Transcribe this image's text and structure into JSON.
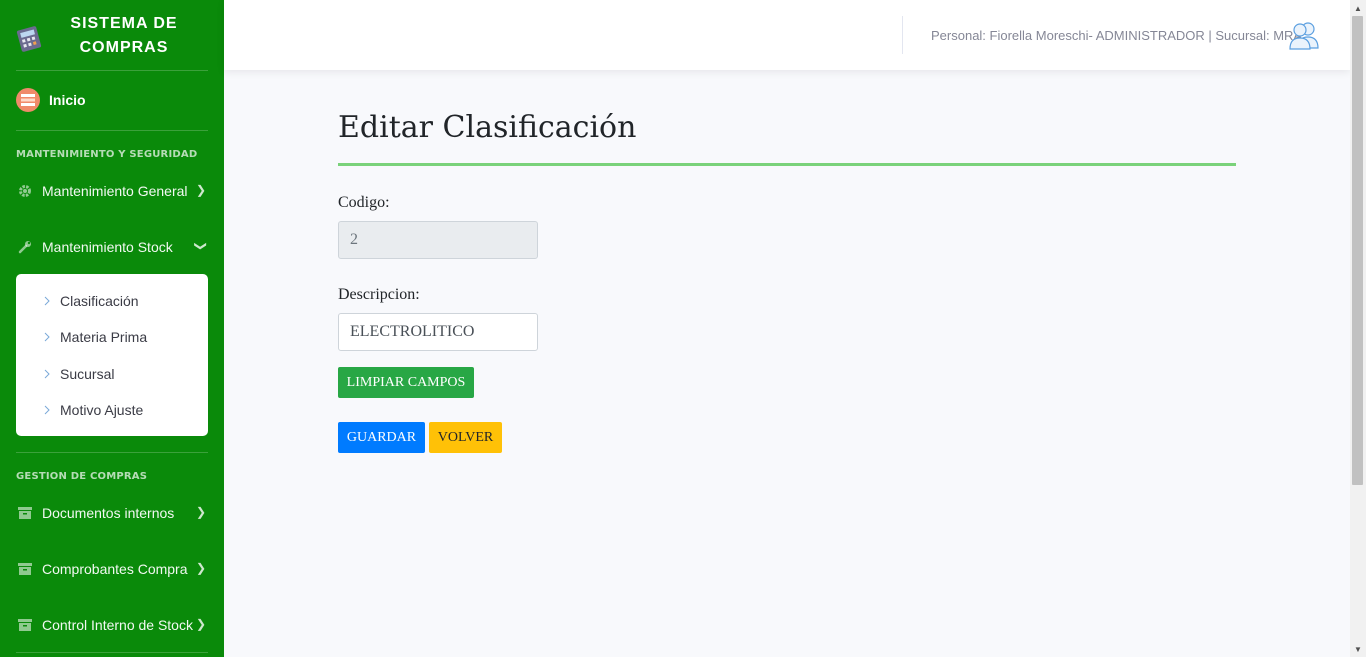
{
  "brand": {
    "line1": "SISTEMA DE",
    "line2": "COMPRAS",
    "logo_icon": "calculator-icon"
  },
  "sidebar": {
    "home_label": "Inicio",
    "section1": "MANTENIMIENTO Y SEGURIDAD",
    "items1": [
      {
        "label": "Mantenimiento General",
        "icon": "gear-icon"
      },
      {
        "label": "Mantenimiento Stock",
        "icon": "wrench-icon"
      }
    ],
    "submenu": [
      "Clasificación",
      "Materia Prima",
      "Sucursal",
      "Motivo Ajuste"
    ],
    "section2": "GESTION DE COMPRAS",
    "items2": [
      {
        "label": "Documentos internos",
        "icon": "archive-icon"
      },
      {
        "label": "Comprobantes Compra",
        "icon": "archive-icon"
      },
      {
        "label": "Control Interno de Stock",
        "icon": "archive-icon"
      }
    ]
  },
  "topbar": {
    "user_text": "Personal: Fiorella Moreschi- ADMINISTRADOR | Sucursal: MRA",
    "avatar_icon": "users-icon"
  },
  "main": {
    "title": "Editar Clasificación",
    "codigo_label": "Codigo:",
    "codigo_value": "2",
    "descripcion_label": "Descripcion:",
    "descripcion_value": "ELECTROLITICO",
    "clear_label": "LIMPIAR CAMPOS",
    "save_label": "GUARDAR",
    "back_label": "VOLVER"
  },
  "colors": {
    "sidebar": "#0a8a0a",
    "accent_rule": "#7ad27a",
    "clear": "#28a745",
    "save": "#007bff",
    "back": "#ffc107"
  }
}
